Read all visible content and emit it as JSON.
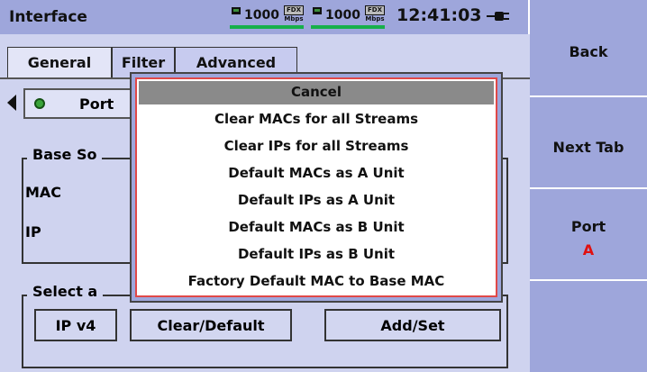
{
  "title_bar": {
    "title": "Interface",
    "link1": {
      "speed": "1000",
      "duplex": "FDX",
      "unit": "Mbps"
    },
    "link2": {
      "speed": "1000",
      "duplex": "FDX",
      "unit": "Mbps"
    },
    "time": "12:41:03",
    "power_icon": "ac-plug-icon"
  },
  "tabs": [
    {
      "label": "General"
    },
    {
      "label": "Filter"
    },
    {
      "label": "Advanced"
    }
  ],
  "port_selector": {
    "label": "Port"
  },
  "base_source": {
    "legend": "Base So",
    "mac_label": "MAC",
    "ip_label": "IP"
  },
  "select_group": {
    "legend": "Select a"
  },
  "buttons": {
    "ipv4": "IP v4",
    "clear_default": "Clear/Default",
    "add_set": "Add/Set"
  },
  "softkeys": {
    "back": "Back",
    "next_tab": "Next Tab",
    "port": "Port",
    "port_value": "A"
  },
  "menu": {
    "cancel": "Cancel",
    "items": [
      "Clear MACs for all Streams",
      "Clear IPs for all Streams",
      "Default MACs as A Unit",
      "Default IPs as A Unit",
      "Default MACs as B Unit",
      "Default IPs as B Unit",
      "Factory Default MAC to Base MAC"
    ]
  },
  "colors": {
    "panel": "#cfd3ef",
    "chrome": "#9ea6db",
    "accent_red": "#e01010",
    "link_green": "#16b04a"
  }
}
